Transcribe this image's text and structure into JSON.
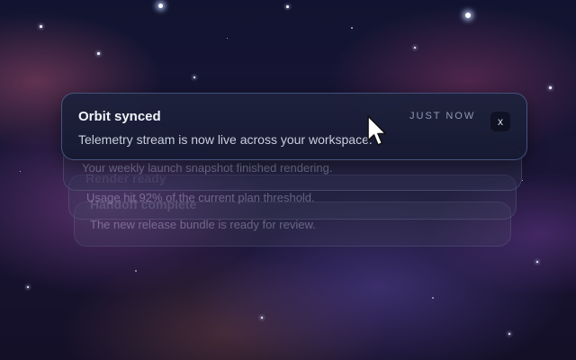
{
  "notifications": [
    {
      "title": "Orbit synced",
      "message": "Telemetry stream is now live across your workspace.",
      "time": "JUST NOW",
      "close_label": "x"
    },
    {
      "title": "Render ready",
      "message": "Your weekly launch snapshot finished rendering."
    },
    {
      "title": "Handoff complete",
      "message": "Usage hit 92% of the current plan threshold."
    },
    {
      "title": "",
      "message": "The new release bundle is ready for review."
    }
  ],
  "icons": {
    "cursor": "mouse-pointer-icon",
    "close": "close-icon"
  },
  "colors": {
    "card_border": "#7896d2",
    "title": "#f2f4fa",
    "message": "#c9cede",
    "timestamp": "#8f98b4"
  }
}
